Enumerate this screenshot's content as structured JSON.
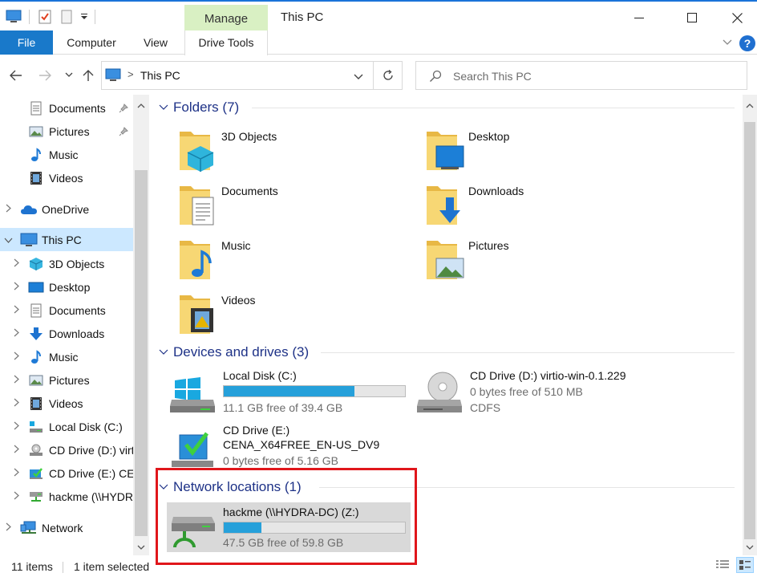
{
  "window": {
    "title": "This PC",
    "contextual_tab": "Manage",
    "controls": {
      "minimize": "minimize",
      "maximize": "maximize",
      "close": "close"
    }
  },
  "ribbon": {
    "tabs": [
      {
        "label": "File",
        "active": true
      },
      {
        "label": "Computer"
      },
      {
        "label": "View"
      },
      {
        "label": "Drive Tools"
      }
    ],
    "help_label": "?"
  },
  "address_bar": {
    "location": "This PC",
    "separator": ">"
  },
  "search": {
    "placeholder": "Search This PC",
    "value": ""
  },
  "nav_pane": {
    "items": [
      {
        "label": "Documents",
        "icon": "documents-icon",
        "pinned": true
      },
      {
        "label": "Pictures",
        "icon": "pictures-icon",
        "pinned": true
      },
      {
        "label": "Music",
        "icon": "music-icon"
      },
      {
        "label": "Videos",
        "icon": "videos-icon"
      },
      {
        "label": "OneDrive",
        "icon": "onedrive-icon"
      },
      {
        "label": "This PC",
        "icon": "computer-icon",
        "selected": true
      },
      {
        "label": "3D Objects",
        "icon": "3d-objects-icon"
      },
      {
        "label": "Desktop",
        "icon": "desktop-icon"
      },
      {
        "label": "Documents",
        "icon": "documents-icon"
      },
      {
        "label": "Downloads",
        "icon": "downloads-icon"
      },
      {
        "label": "Music",
        "icon": "music-icon"
      },
      {
        "label": "Pictures",
        "icon": "pictures-icon"
      },
      {
        "label": "Videos",
        "icon": "videos-icon"
      },
      {
        "label": "Local Disk (C:)",
        "icon": "local-disk-icon"
      },
      {
        "label": "CD Drive (D:) virt",
        "icon": "cd-drive-icon"
      },
      {
        "label": "CD Drive (E:) CEN",
        "icon": "cd-drive-icon"
      },
      {
        "label": "hackme (\\\\HYDR",
        "icon": "network-drive-icon"
      },
      {
        "label": "Network",
        "icon": "network-icon"
      }
    ]
  },
  "groups": {
    "folders": {
      "title": "Folders (7)",
      "items": [
        {
          "name": "3D Objects",
          "icon": "3d-objects-folder-icon"
        },
        {
          "name": "Desktop",
          "icon": "desktop-folder-icon"
        },
        {
          "name": "Documents",
          "icon": "documents-folder-icon"
        },
        {
          "name": "Downloads",
          "icon": "downloads-folder-icon"
        },
        {
          "name": "Music",
          "icon": "music-folder-icon"
        },
        {
          "name": "Pictures",
          "icon": "pictures-folder-icon"
        },
        {
          "name": "Videos",
          "icon": "videos-folder-icon"
        }
      ]
    },
    "devices": {
      "title": "Devices and drives (3)",
      "items": [
        {
          "name": "Local Disk (C:)",
          "free_text": "11.1 GB free of 39.4 GB",
          "used_fraction": 0.72,
          "icon": "local-disk-icon"
        },
        {
          "name": "CD Drive (D:) virtio-win-0.1.229",
          "free_text": "0 bytes free of 510 MB",
          "fs": "CDFS",
          "icon": "cd-drive-icon"
        },
        {
          "name": "CD Drive (E:)",
          "volume_label": "CENA_X64FREE_EN-US_DV9",
          "free_text": "0 bytes free of 5.16 GB",
          "icon": "cd-setup-icon"
        }
      ]
    },
    "network": {
      "title": "Network locations (1)",
      "items": [
        {
          "name": "hackme (\\\\HYDRA-DC) (Z:)",
          "free_text": "47.5 GB free of 59.8 GB",
          "used_fraction": 0.21,
          "icon": "network-drive-icon"
        }
      ]
    }
  },
  "status_bar": {
    "item_count": "11 items",
    "selection": "1 item selected"
  },
  "colors": {
    "accent": "#1979ca",
    "group_title": "#1e3287",
    "usage_bar": "#26a0da",
    "selection": "#cce8ff",
    "manage_tab": "#d9f0c3",
    "highlight_box": "#e0161b"
  }
}
